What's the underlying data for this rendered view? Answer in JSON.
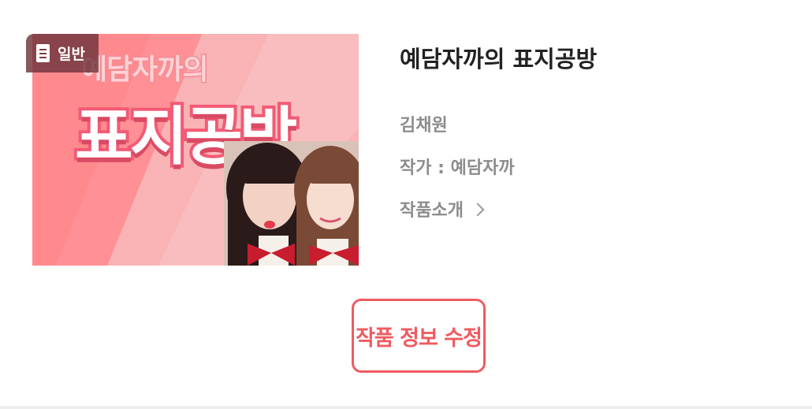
{
  "badge": {
    "label": "일반",
    "icon": "document-icon"
  },
  "cover": {
    "small_title": "예담자까의",
    "big_title": "표지공방",
    "colors": {
      "background": "#f7a7a9",
      "stripe": "#ff8a8e",
      "title_stroke": "#f35a75"
    }
  },
  "work": {
    "title": "예담자까의 표지공방",
    "name": "김채원",
    "author": "작가 : 예담자까",
    "intro_label": "작품소개",
    "intro_icon": "chevron-right-icon"
  },
  "edit_button": {
    "label": "작품 정보 수정",
    "color": "#ef5b60"
  }
}
